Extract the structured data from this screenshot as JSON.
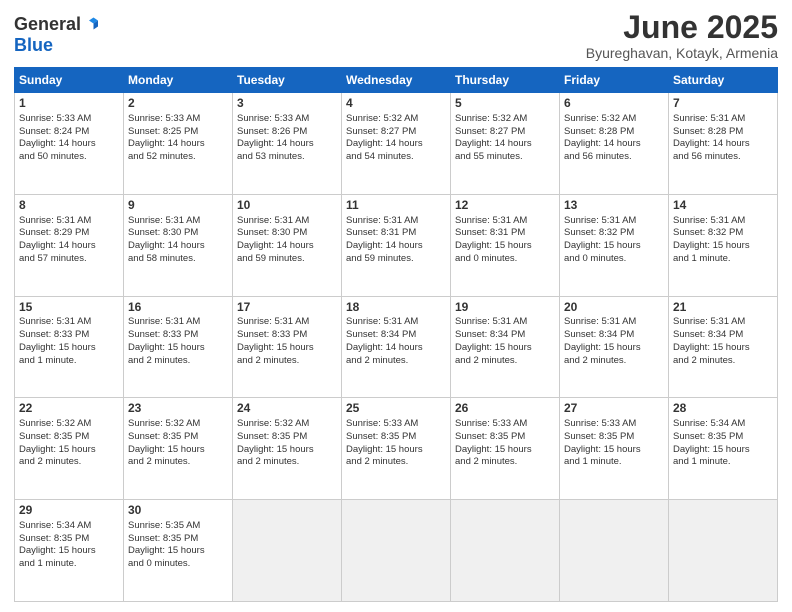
{
  "logo": {
    "general": "General",
    "blue": "Blue"
  },
  "header": {
    "title": "June 2025",
    "location": "Byureghavan, Kotayk, Armenia"
  },
  "weekdays": [
    "Sunday",
    "Monday",
    "Tuesday",
    "Wednesday",
    "Thursday",
    "Friday",
    "Saturday"
  ],
  "weeks": [
    [
      {
        "day": "1",
        "info": "Sunrise: 5:33 AM\nSunset: 8:24 PM\nDaylight: 14 hours\nand 50 minutes."
      },
      {
        "day": "2",
        "info": "Sunrise: 5:33 AM\nSunset: 8:25 PM\nDaylight: 14 hours\nand 52 minutes."
      },
      {
        "day": "3",
        "info": "Sunrise: 5:33 AM\nSunset: 8:26 PM\nDaylight: 14 hours\nand 53 minutes."
      },
      {
        "day": "4",
        "info": "Sunrise: 5:32 AM\nSunset: 8:27 PM\nDaylight: 14 hours\nand 54 minutes."
      },
      {
        "day": "5",
        "info": "Sunrise: 5:32 AM\nSunset: 8:27 PM\nDaylight: 14 hours\nand 55 minutes."
      },
      {
        "day": "6",
        "info": "Sunrise: 5:32 AM\nSunset: 8:28 PM\nDaylight: 14 hours\nand 56 minutes."
      },
      {
        "day": "7",
        "info": "Sunrise: 5:31 AM\nSunset: 8:28 PM\nDaylight: 14 hours\nand 56 minutes."
      }
    ],
    [
      {
        "day": "8",
        "info": "Sunrise: 5:31 AM\nSunset: 8:29 PM\nDaylight: 14 hours\nand 57 minutes."
      },
      {
        "day": "9",
        "info": "Sunrise: 5:31 AM\nSunset: 8:30 PM\nDaylight: 14 hours\nand 58 minutes."
      },
      {
        "day": "10",
        "info": "Sunrise: 5:31 AM\nSunset: 8:30 PM\nDaylight: 14 hours\nand 59 minutes."
      },
      {
        "day": "11",
        "info": "Sunrise: 5:31 AM\nSunset: 8:31 PM\nDaylight: 14 hours\nand 59 minutes."
      },
      {
        "day": "12",
        "info": "Sunrise: 5:31 AM\nSunset: 8:31 PM\nDaylight: 15 hours\nand 0 minutes."
      },
      {
        "day": "13",
        "info": "Sunrise: 5:31 AM\nSunset: 8:32 PM\nDaylight: 15 hours\nand 0 minutes."
      },
      {
        "day": "14",
        "info": "Sunrise: 5:31 AM\nSunset: 8:32 PM\nDaylight: 15 hours\nand 1 minute."
      }
    ],
    [
      {
        "day": "15",
        "info": "Sunrise: 5:31 AM\nSunset: 8:33 PM\nDaylight: 15 hours\nand 1 minute."
      },
      {
        "day": "16",
        "info": "Sunrise: 5:31 AM\nSunset: 8:33 PM\nDaylight: 15 hours\nand 2 minutes."
      },
      {
        "day": "17",
        "info": "Sunrise: 5:31 AM\nSunset: 8:33 PM\nDaylight: 15 hours\nand 2 minutes."
      },
      {
        "day": "18",
        "info": "Sunrise: 5:31 AM\nSunset: 8:34 PM\nDaylight: 14 hours\nand 2 minutes."
      },
      {
        "day": "19",
        "info": "Sunrise: 5:31 AM\nSunset: 8:34 PM\nDaylight: 15 hours\nand 2 minutes."
      },
      {
        "day": "20",
        "info": "Sunrise: 5:31 AM\nSunset: 8:34 PM\nDaylight: 15 hours\nand 2 minutes."
      },
      {
        "day": "21",
        "info": "Sunrise: 5:31 AM\nSunset: 8:34 PM\nDaylight: 15 hours\nand 2 minutes."
      }
    ],
    [
      {
        "day": "22",
        "info": "Sunrise: 5:32 AM\nSunset: 8:35 PM\nDaylight: 15 hours\nand 2 minutes."
      },
      {
        "day": "23",
        "info": "Sunrise: 5:32 AM\nSunset: 8:35 PM\nDaylight: 15 hours\nand 2 minutes."
      },
      {
        "day": "24",
        "info": "Sunrise: 5:32 AM\nSunset: 8:35 PM\nDaylight: 15 hours\nand 2 minutes."
      },
      {
        "day": "25",
        "info": "Sunrise: 5:33 AM\nSunset: 8:35 PM\nDaylight: 15 hours\nand 2 minutes."
      },
      {
        "day": "26",
        "info": "Sunrise: 5:33 AM\nSunset: 8:35 PM\nDaylight: 15 hours\nand 2 minutes."
      },
      {
        "day": "27",
        "info": "Sunrise: 5:33 AM\nSunset: 8:35 PM\nDaylight: 15 hours\nand 1 minute."
      },
      {
        "day": "28",
        "info": "Sunrise: 5:34 AM\nSunset: 8:35 PM\nDaylight: 15 hours\nand 1 minute."
      }
    ],
    [
      {
        "day": "29",
        "info": "Sunrise: 5:34 AM\nSunset: 8:35 PM\nDaylight: 15 hours\nand 1 minute."
      },
      {
        "day": "30",
        "info": "Sunrise: 5:35 AM\nSunset: 8:35 PM\nDaylight: 15 hours\nand 0 minutes."
      },
      null,
      null,
      null,
      null,
      null
    ]
  ]
}
